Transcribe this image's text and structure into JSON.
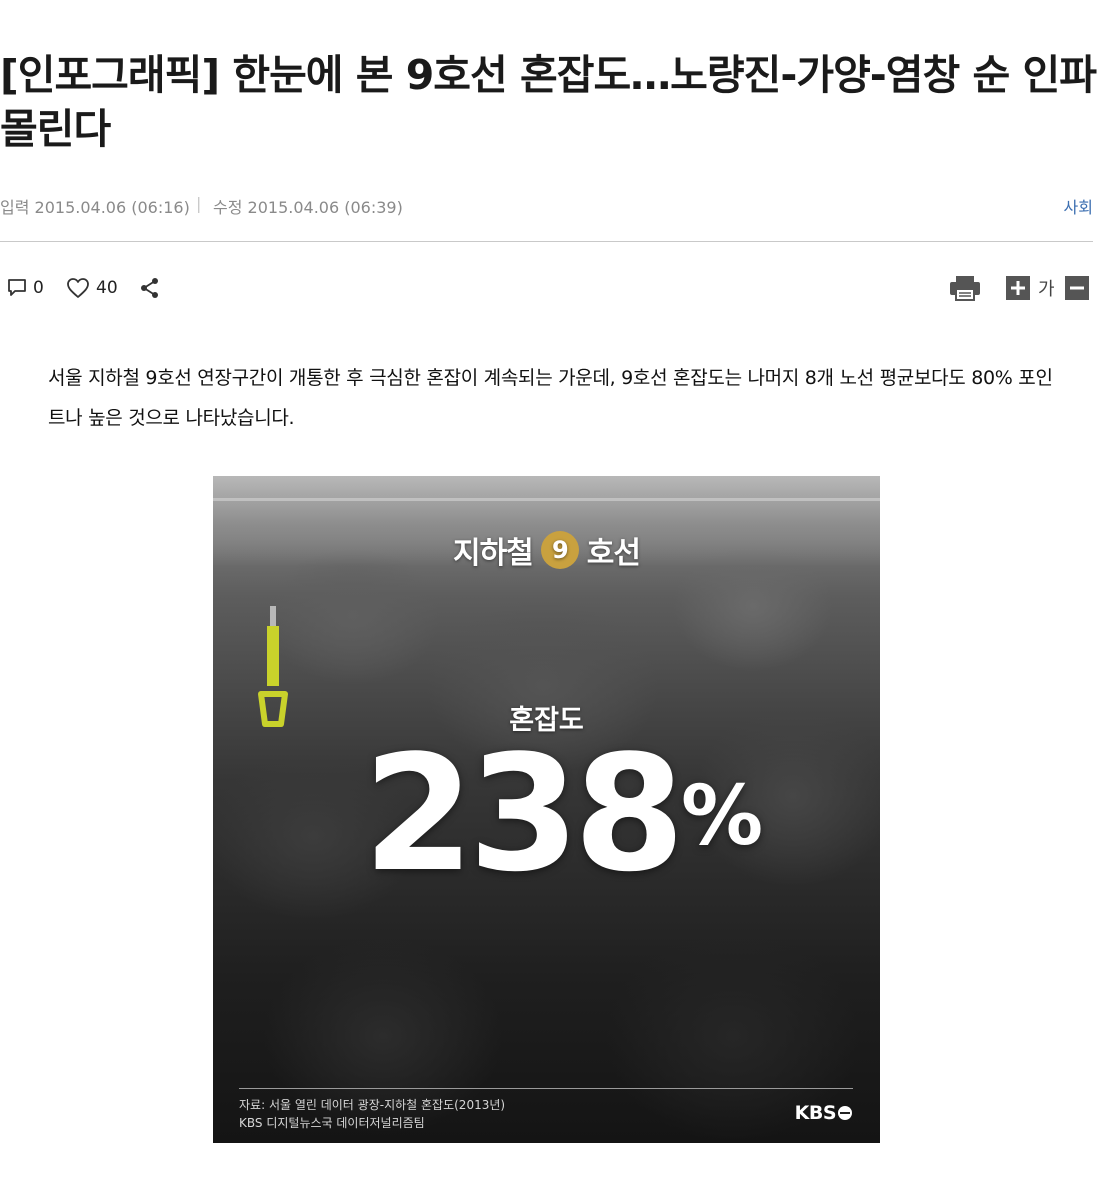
{
  "article": {
    "headline": "[인포그래픽] 한눈에 본 9호선 혼잡도…노량진-가양-염창 순 인파 몰린다",
    "published": "입력 2015.04.06 (06:16)",
    "modified": "수정 2015.04.06 (06:39)",
    "separator": "|",
    "section": "사회",
    "lead": "서울 지하철 9호선 연장구간이 개통한 후 극심한 혼잡이 계속되는 가운데, 9호선 혼잡도는 나머지 8개 노선 평균보다도 80% 포인트나 높은 것으로 나타났습니다."
  },
  "actions": {
    "comment_icon": "comment-icon",
    "comment_count": "0",
    "like_icon": "heart-icon",
    "like_count": "40",
    "share_icon": "share-icon",
    "print_icon": "print-icon",
    "font_increase_icon": "plus-icon",
    "font_label": "가",
    "font_decrease_icon": "minus-icon"
  },
  "infographic": {
    "title_prefix": "지하철",
    "line_number": "9",
    "title_suffix": "호선",
    "label": "혼잡도",
    "value": "238",
    "unit": "%",
    "source_line1": "자료: 서울 열린 데이터 광장-지하철 혼잡도(2013년)",
    "source_line2": "KBS 디지털뉴스국 데이터저널리즘팀",
    "logo": "KBS",
    "badge_color": "#c9a13f"
  },
  "colors": {
    "section_link": "#3b6eb0",
    "meta_text": "#8a8a8a"
  }
}
